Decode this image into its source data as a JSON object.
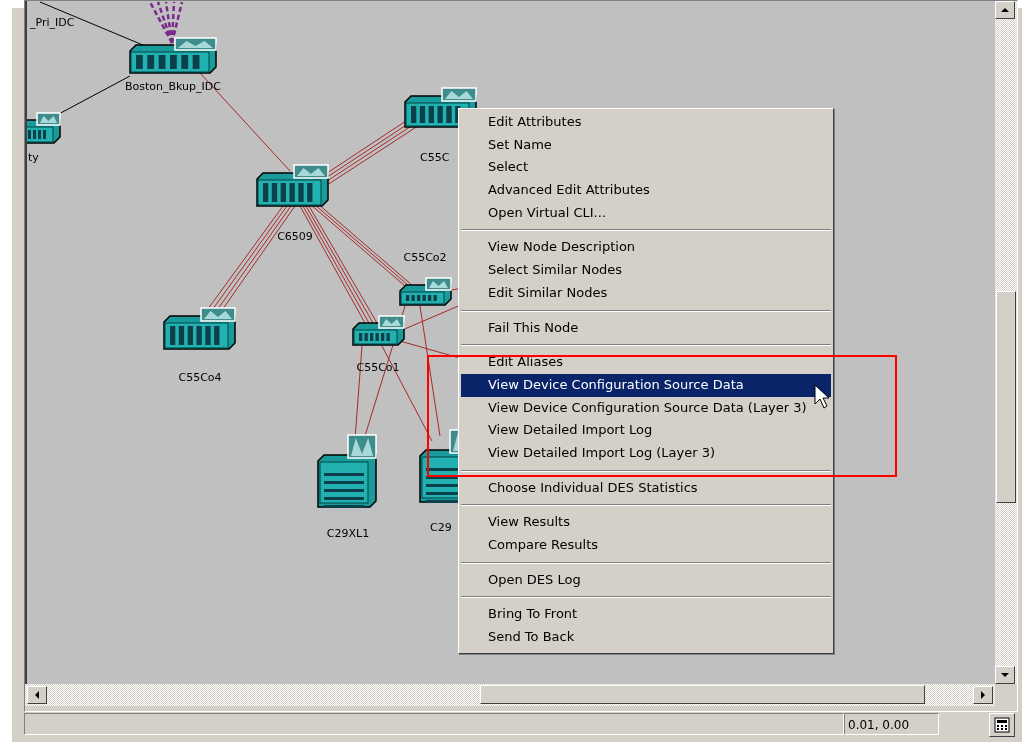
{
  "nodes": [
    {
      "label": "_Pri_IDC"
    },
    {
      "kind": "switch",
      "label": "Boston_Bkup_IDC"
    },
    {
      "kind": "switch",
      "label": "ty"
    },
    {
      "kind": "switch",
      "label": "C6509"
    },
    {
      "kind": "switch",
      "label": "C55C"
    },
    {
      "kind": "switch",
      "label": "C55Co4"
    },
    {
      "kind": "switch",
      "label": "C55Co2"
    },
    {
      "kind": "switch",
      "label": "C55Co1"
    },
    {
      "kind": "chassis",
      "label": "C29XL1"
    },
    {
      "kind": "chassis",
      "label": "C29"
    }
  ],
  "context_menu": {
    "groups": [
      [
        {
          "label": "Edit Attributes",
          "selected": false
        },
        {
          "label": "Set Name",
          "selected": false
        },
        {
          "label": "Select",
          "selected": false
        },
        {
          "label": "Advanced Edit Attributes",
          "selected": false
        },
        {
          "label": "Open Virtual CLI...",
          "selected": false
        }
      ],
      [
        {
          "label": "View Node Description",
          "selected": false
        },
        {
          "label": "Select Similar Nodes",
          "selected": false
        },
        {
          "label": "Edit Similar Nodes",
          "selected": false
        }
      ],
      [
        {
          "label": "Fail This Node",
          "selected": false
        }
      ],
      [
        {
          "label": "Edit Aliases",
          "selected": false
        },
        {
          "label": "View Device Configuration Source Data",
          "selected": true
        },
        {
          "label": "View Device Configuration Source Data (Layer 3)",
          "selected": false
        },
        {
          "label": "View Detailed Import Log",
          "selected": false
        },
        {
          "label": "View Detailed Import Log (Layer 3)",
          "selected": false
        }
      ],
      [
        {
          "label": "Choose Individual DES Statistics",
          "selected": false
        }
      ],
      [
        {
          "label": "View Results",
          "selected": false
        },
        {
          "label": "Compare Results",
          "selected": false
        }
      ],
      [
        {
          "label": "Open DES Log",
          "selected": false
        }
      ],
      [
        {
          "label": "Bring To Front",
          "selected": false
        },
        {
          "label": "Send To Back",
          "selected": false
        }
      ]
    ]
  },
  "status_bar": {
    "coordinates": "0.01, 0.00"
  }
}
